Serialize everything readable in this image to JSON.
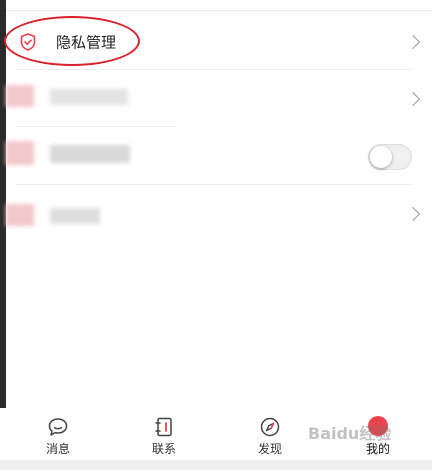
{
  "menu": {
    "privacy_label": "隐私管理"
  },
  "tabbar": {
    "items": [
      {
        "label": "消息",
        "icon": "chat-bubble-icon"
      },
      {
        "label": "联系",
        "icon": "contacts-book-icon"
      },
      {
        "label": "发现",
        "icon": "compass-icon"
      },
      {
        "label": "我的",
        "icon": "avatar-icon"
      }
    ]
  },
  "watermark": "Baidu经验",
  "colors": {
    "accent": "#e8434f",
    "annotation": "#d8222d",
    "divider": "#eeeeee"
  }
}
